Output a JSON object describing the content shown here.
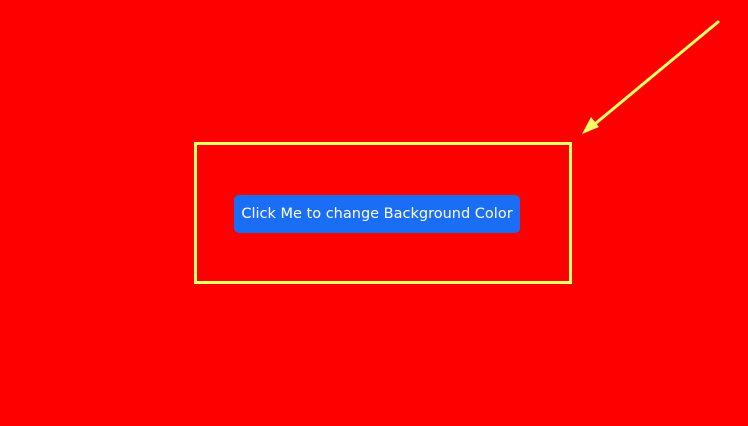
{
  "page": {
    "background_color": "#ff0000"
  },
  "button": {
    "label": "Click Me to change Background Color",
    "color": "#1a6ef5"
  },
  "annotation": {
    "color": "#ffff66",
    "arrow_icon": "arrow-icon",
    "highlight": "highlight-box"
  }
}
